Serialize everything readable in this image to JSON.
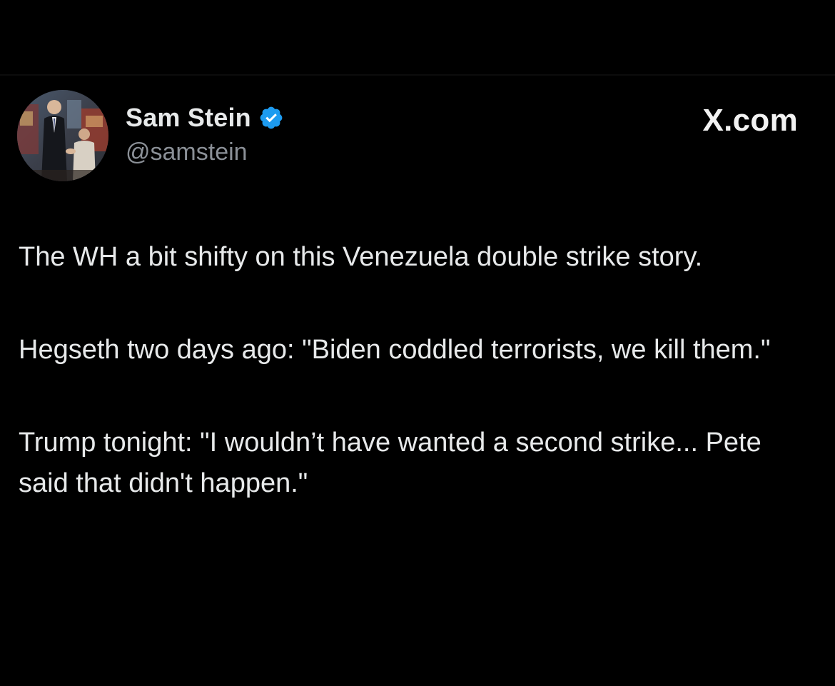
{
  "tweet": {
    "author": {
      "display_name": "Sam Stein",
      "handle": "@samstein",
      "verified": true,
      "avatar_icon": "profile-photo"
    },
    "brand": "X.com",
    "body": {
      "paragraphs": [
        "The WH a bit shifty on this Venezuela double strike story.",
        "Hegseth two days ago: \"Biden coddled terrorists, we kill them.\"",
        "Trump tonight: \"I wouldn’t have wanted a second strike... Pete said that didn't happen.\""
      ]
    }
  },
  "colors": {
    "background": "#000000",
    "text_primary": "#e7e9ea",
    "text_secondary": "#8b9097",
    "verified_badge": "#1d9bf0"
  }
}
